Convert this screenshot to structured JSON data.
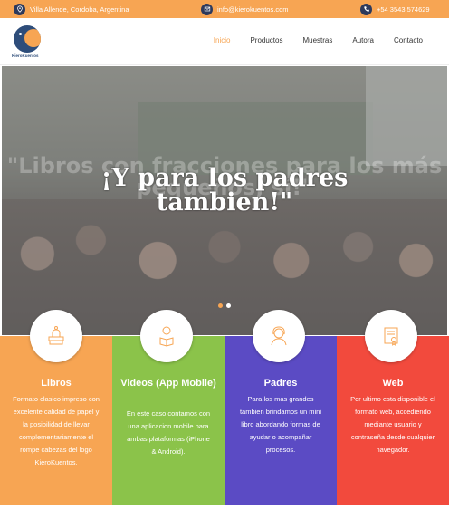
{
  "topbar": {
    "address": "Villa Allende, Cordoba, Argentina",
    "email": "info@kierokuentos.com",
    "phone": "+54 3543 574629",
    "icons": [
      "location-icon",
      "mail-icon",
      "phone-icon"
    ]
  },
  "brand": {
    "name": "KieroKuentos"
  },
  "nav": {
    "items": [
      {
        "label": "Inicio",
        "active": true
      },
      {
        "label": "Productos",
        "active": false
      },
      {
        "label": "Muestras",
        "active": false
      },
      {
        "label": "Autora",
        "active": false
      },
      {
        "label": "Contacto",
        "active": false
      }
    ]
  },
  "hero": {
    "headline_line1": "¡Y para los padres",
    "headline_line2": "tambien!\"",
    "ghost_text": "\"Libros con fracciones para los más pequeños, sí!\"",
    "slides": 2,
    "active_slide": 1
  },
  "features": [
    {
      "title": "Libros",
      "description": "Formato clasico impreso con excelente calidad de papel y la posibilidad de llevar complementariamente el rompe cabezas del logo KieroKuentos.",
      "color": "#f7a553",
      "icon": "books-icon"
    },
    {
      "title": "Videos (App Mobile)",
      "description": "En este caso contamos con una aplicacion mobile para ambas plataformas (iPhone & Android).",
      "color": "#8bc34a",
      "icon": "child-reading-icon"
    },
    {
      "title": "Padres",
      "description": "Para los mas grandes tambien brindamos un mini libro abordando formas de ayudar o acompañar procesos.",
      "color": "#5b4bc4",
      "icon": "woman-icon"
    },
    {
      "title": "Web",
      "description": "Por ultimo esta disponible el formato web, accediendo mediante usuario y contraseña desde cualquier navegador.",
      "color": "#f24a3d",
      "icon": "certificate-icon"
    }
  ],
  "colors": {
    "accent": "#f7a553",
    "dark_blue": "#2e3a5c"
  }
}
